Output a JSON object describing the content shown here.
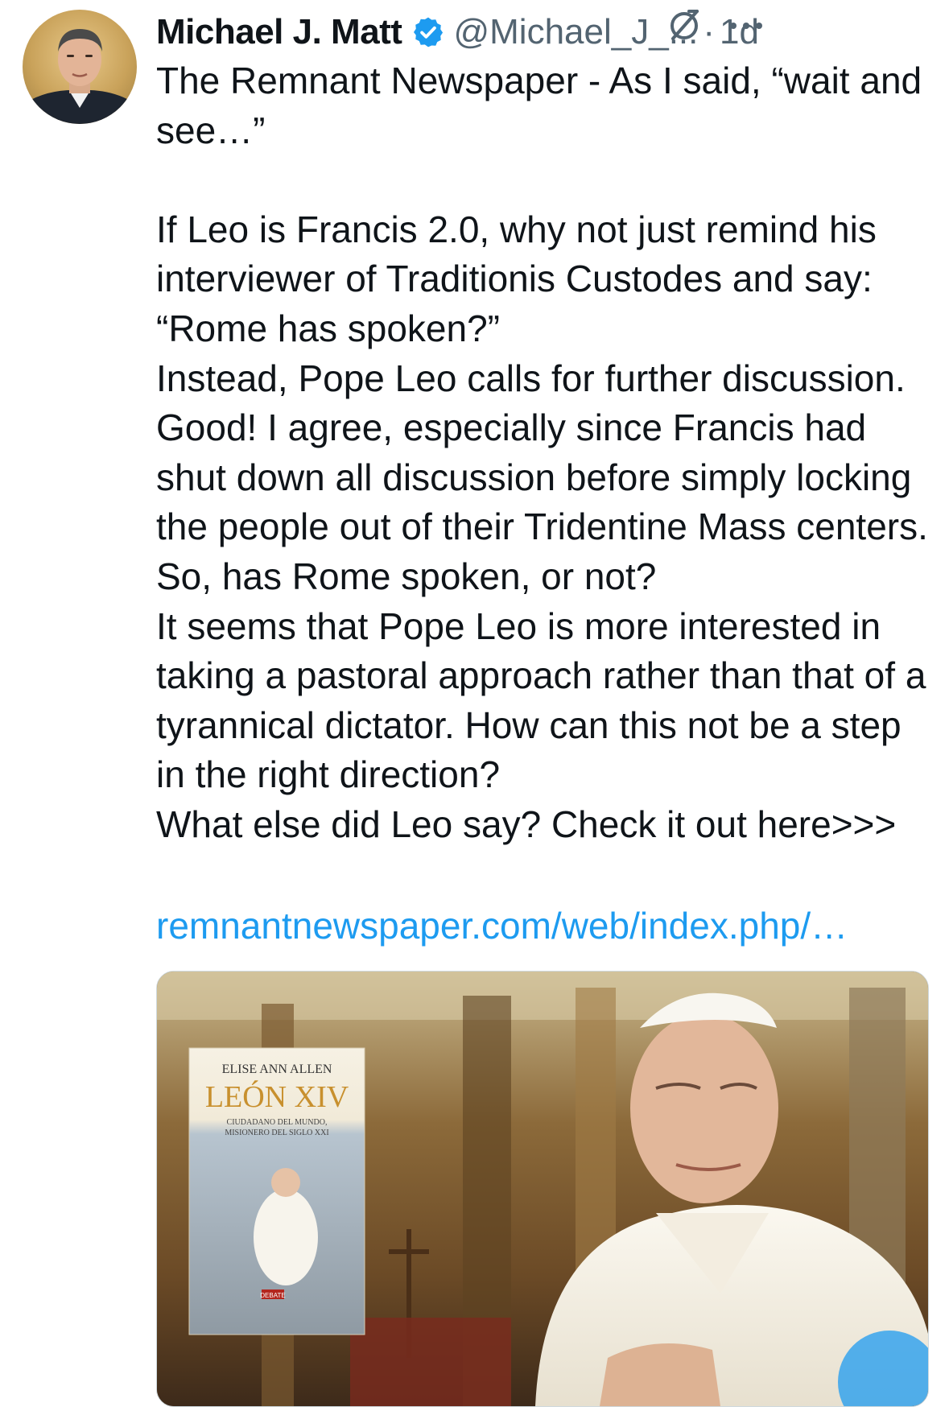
{
  "tweet": {
    "author_name": "Michael J. Matt",
    "handle": "@Michael_J_...",
    "separator": "·",
    "time": "1d",
    "body": "The Remnant Newspaper - As I said, “wait and see…”\n\nIf Leo is Francis 2.0, why not just remind his interviewer of Traditionis Custodes and say: “Rome has spoken?”\nInstead, Pope Leo calls for further discussion. Good! I agree, especially since Francis had shut down all discussion before simply locking the people out of their Tridentine Mass centers. So, has Rome spoken, or not?\nIt seems that Pope Leo is more interested in taking a pastoral approach rather than that of a tyrannical dictator. How can this not be a step in the right direction?\nWhat else did Leo say? Check it out here>>>",
    "link": "remnantnewspaper.com/web/index.php/…"
  },
  "media": {
    "book_author": "ELISE ANN ALLEN",
    "book_title": "LEÓN XIV",
    "book_subtitle_1": "CIUDADANO DEL MUNDO,",
    "book_subtitle_2": "MISIONERO DEL SIGLO XXI",
    "publisher": "DEBATE"
  },
  "icons": {
    "verified": "verified-badge-icon",
    "grok": "grok-icon",
    "more": "more-options-icon"
  },
  "colors": {
    "accent": "#1d9bf0",
    "secondary_text": "#536471",
    "text": "#0f1419"
  }
}
